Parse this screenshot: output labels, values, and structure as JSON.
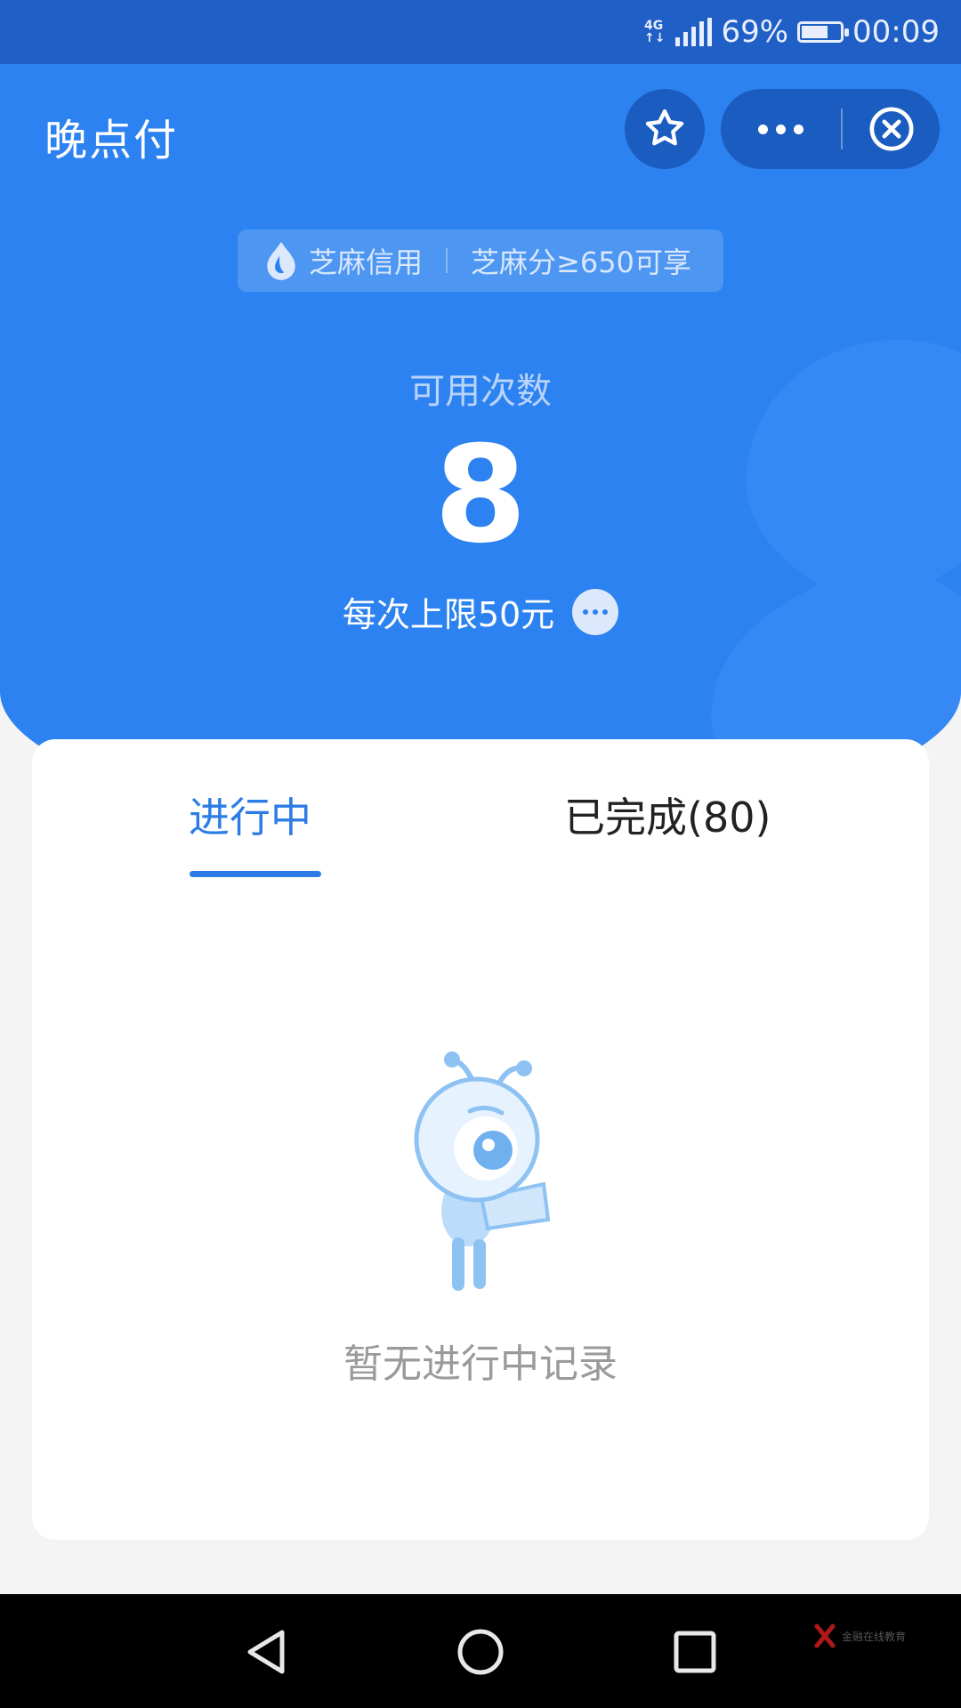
{
  "status_bar": {
    "network": "4G",
    "battery": "69%",
    "time": "00:09"
  },
  "header": {
    "title": "晚点付"
  },
  "zhima": {
    "brand": "芝麻信用",
    "requirement": "芝麻分≥650可享"
  },
  "summary": {
    "label": "可用次数",
    "count": "8",
    "limit": "每次上限50元"
  },
  "tabs": [
    {
      "label": "进行中",
      "active": true
    },
    {
      "label": "已完成(80)",
      "active": false
    }
  ],
  "empty_state": {
    "message": "暂无进行中记录"
  },
  "corner_watermark": "金融在线教育",
  "colors": {
    "primary": "#2c82f0",
    "status_bar": "#1f5fc6",
    "tab_active": "#2c7ce6"
  }
}
